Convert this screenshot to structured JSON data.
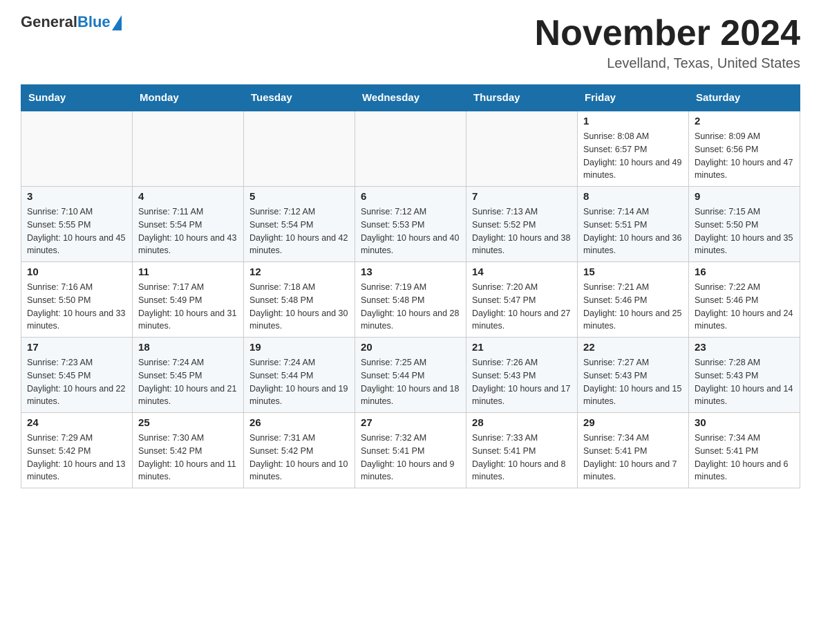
{
  "header": {
    "logo_text_black": "General",
    "logo_text_blue": "Blue",
    "month_title": "November 2024",
    "location": "Levelland, Texas, United States"
  },
  "days_of_week": [
    "Sunday",
    "Monday",
    "Tuesday",
    "Wednesday",
    "Thursday",
    "Friday",
    "Saturday"
  ],
  "weeks": [
    [
      {
        "day": "",
        "info": ""
      },
      {
        "day": "",
        "info": ""
      },
      {
        "day": "",
        "info": ""
      },
      {
        "day": "",
        "info": ""
      },
      {
        "day": "",
        "info": ""
      },
      {
        "day": "1",
        "info": "Sunrise: 8:08 AM\nSunset: 6:57 PM\nDaylight: 10 hours and 49 minutes."
      },
      {
        "day": "2",
        "info": "Sunrise: 8:09 AM\nSunset: 6:56 PM\nDaylight: 10 hours and 47 minutes."
      }
    ],
    [
      {
        "day": "3",
        "info": "Sunrise: 7:10 AM\nSunset: 5:55 PM\nDaylight: 10 hours and 45 minutes."
      },
      {
        "day": "4",
        "info": "Sunrise: 7:11 AM\nSunset: 5:54 PM\nDaylight: 10 hours and 43 minutes."
      },
      {
        "day": "5",
        "info": "Sunrise: 7:12 AM\nSunset: 5:54 PM\nDaylight: 10 hours and 42 minutes."
      },
      {
        "day": "6",
        "info": "Sunrise: 7:12 AM\nSunset: 5:53 PM\nDaylight: 10 hours and 40 minutes."
      },
      {
        "day": "7",
        "info": "Sunrise: 7:13 AM\nSunset: 5:52 PM\nDaylight: 10 hours and 38 minutes."
      },
      {
        "day": "8",
        "info": "Sunrise: 7:14 AM\nSunset: 5:51 PM\nDaylight: 10 hours and 36 minutes."
      },
      {
        "day": "9",
        "info": "Sunrise: 7:15 AM\nSunset: 5:50 PM\nDaylight: 10 hours and 35 minutes."
      }
    ],
    [
      {
        "day": "10",
        "info": "Sunrise: 7:16 AM\nSunset: 5:50 PM\nDaylight: 10 hours and 33 minutes."
      },
      {
        "day": "11",
        "info": "Sunrise: 7:17 AM\nSunset: 5:49 PM\nDaylight: 10 hours and 31 minutes."
      },
      {
        "day": "12",
        "info": "Sunrise: 7:18 AM\nSunset: 5:48 PM\nDaylight: 10 hours and 30 minutes."
      },
      {
        "day": "13",
        "info": "Sunrise: 7:19 AM\nSunset: 5:48 PM\nDaylight: 10 hours and 28 minutes."
      },
      {
        "day": "14",
        "info": "Sunrise: 7:20 AM\nSunset: 5:47 PM\nDaylight: 10 hours and 27 minutes."
      },
      {
        "day": "15",
        "info": "Sunrise: 7:21 AM\nSunset: 5:46 PM\nDaylight: 10 hours and 25 minutes."
      },
      {
        "day": "16",
        "info": "Sunrise: 7:22 AM\nSunset: 5:46 PM\nDaylight: 10 hours and 24 minutes."
      }
    ],
    [
      {
        "day": "17",
        "info": "Sunrise: 7:23 AM\nSunset: 5:45 PM\nDaylight: 10 hours and 22 minutes."
      },
      {
        "day": "18",
        "info": "Sunrise: 7:24 AM\nSunset: 5:45 PM\nDaylight: 10 hours and 21 minutes."
      },
      {
        "day": "19",
        "info": "Sunrise: 7:24 AM\nSunset: 5:44 PM\nDaylight: 10 hours and 19 minutes."
      },
      {
        "day": "20",
        "info": "Sunrise: 7:25 AM\nSunset: 5:44 PM\nDaylight: 10 hours and 18 minutes."
      },
      {
        "day": "21",
        "info": "Sunrise: 7:26 AM\nSunset: 5:43 PM\nDaylight: 10 hours and 17 minutes."
      },
      {
        "day": "22",
        "info": "Sunrise: 7:27 AM\nSunset: 5:43 PM\nDaylight: 10 hours and 15 minutes."
      },
      {
        "day": "23",
        "info": "Sunrise: 7:28 AM\nSunset: 5:43 PM\nDaylight: 10 hours and 14 minutes."
      }
    ],
    [
      {
        "day": "24",
        "info": "Sunrise: 7:29 AM\nSunset: 5:42 PM\nDaylight: 10 hours and 13 minutes."
      },
      {
        "day": "25",
        "info": "Sunrise: 7:30 AM\nSunset: 5:42 PM\nDaylight: 10 hours and 11 minutes."
      },
      {
        "day": "26",
        "info": "Sunrise: 7:31 AM\nSunset: 5:42 PM\nDaylight: 10 hours and 10 minutes."
      },
      {
        "day": "27",
        "info": "Sunrise: 7:32 AM\nSunset: 5:41 PM\nDaylight: 10 hours and 9 minutes."
      },
      {
        "day": "28",
        "info": "Sunrise: 7:33 AM\nSunset: 5:41 PM\nDaylight: 10 hours and 8 minutes."
      },
      {
        "day": "29",
        "info": "Sunrise: 7:34 AM\nSunset: 5:41 PM\nDaylight: 10 hours and 7 minutes."
      },
      {
        "day": "30",
        "info": "Sunrise: 7:34 AM\nSunset: 5:41 PM\nDaylight: 10 hours and 6 minutes."
      }
    ]
  ]
}
